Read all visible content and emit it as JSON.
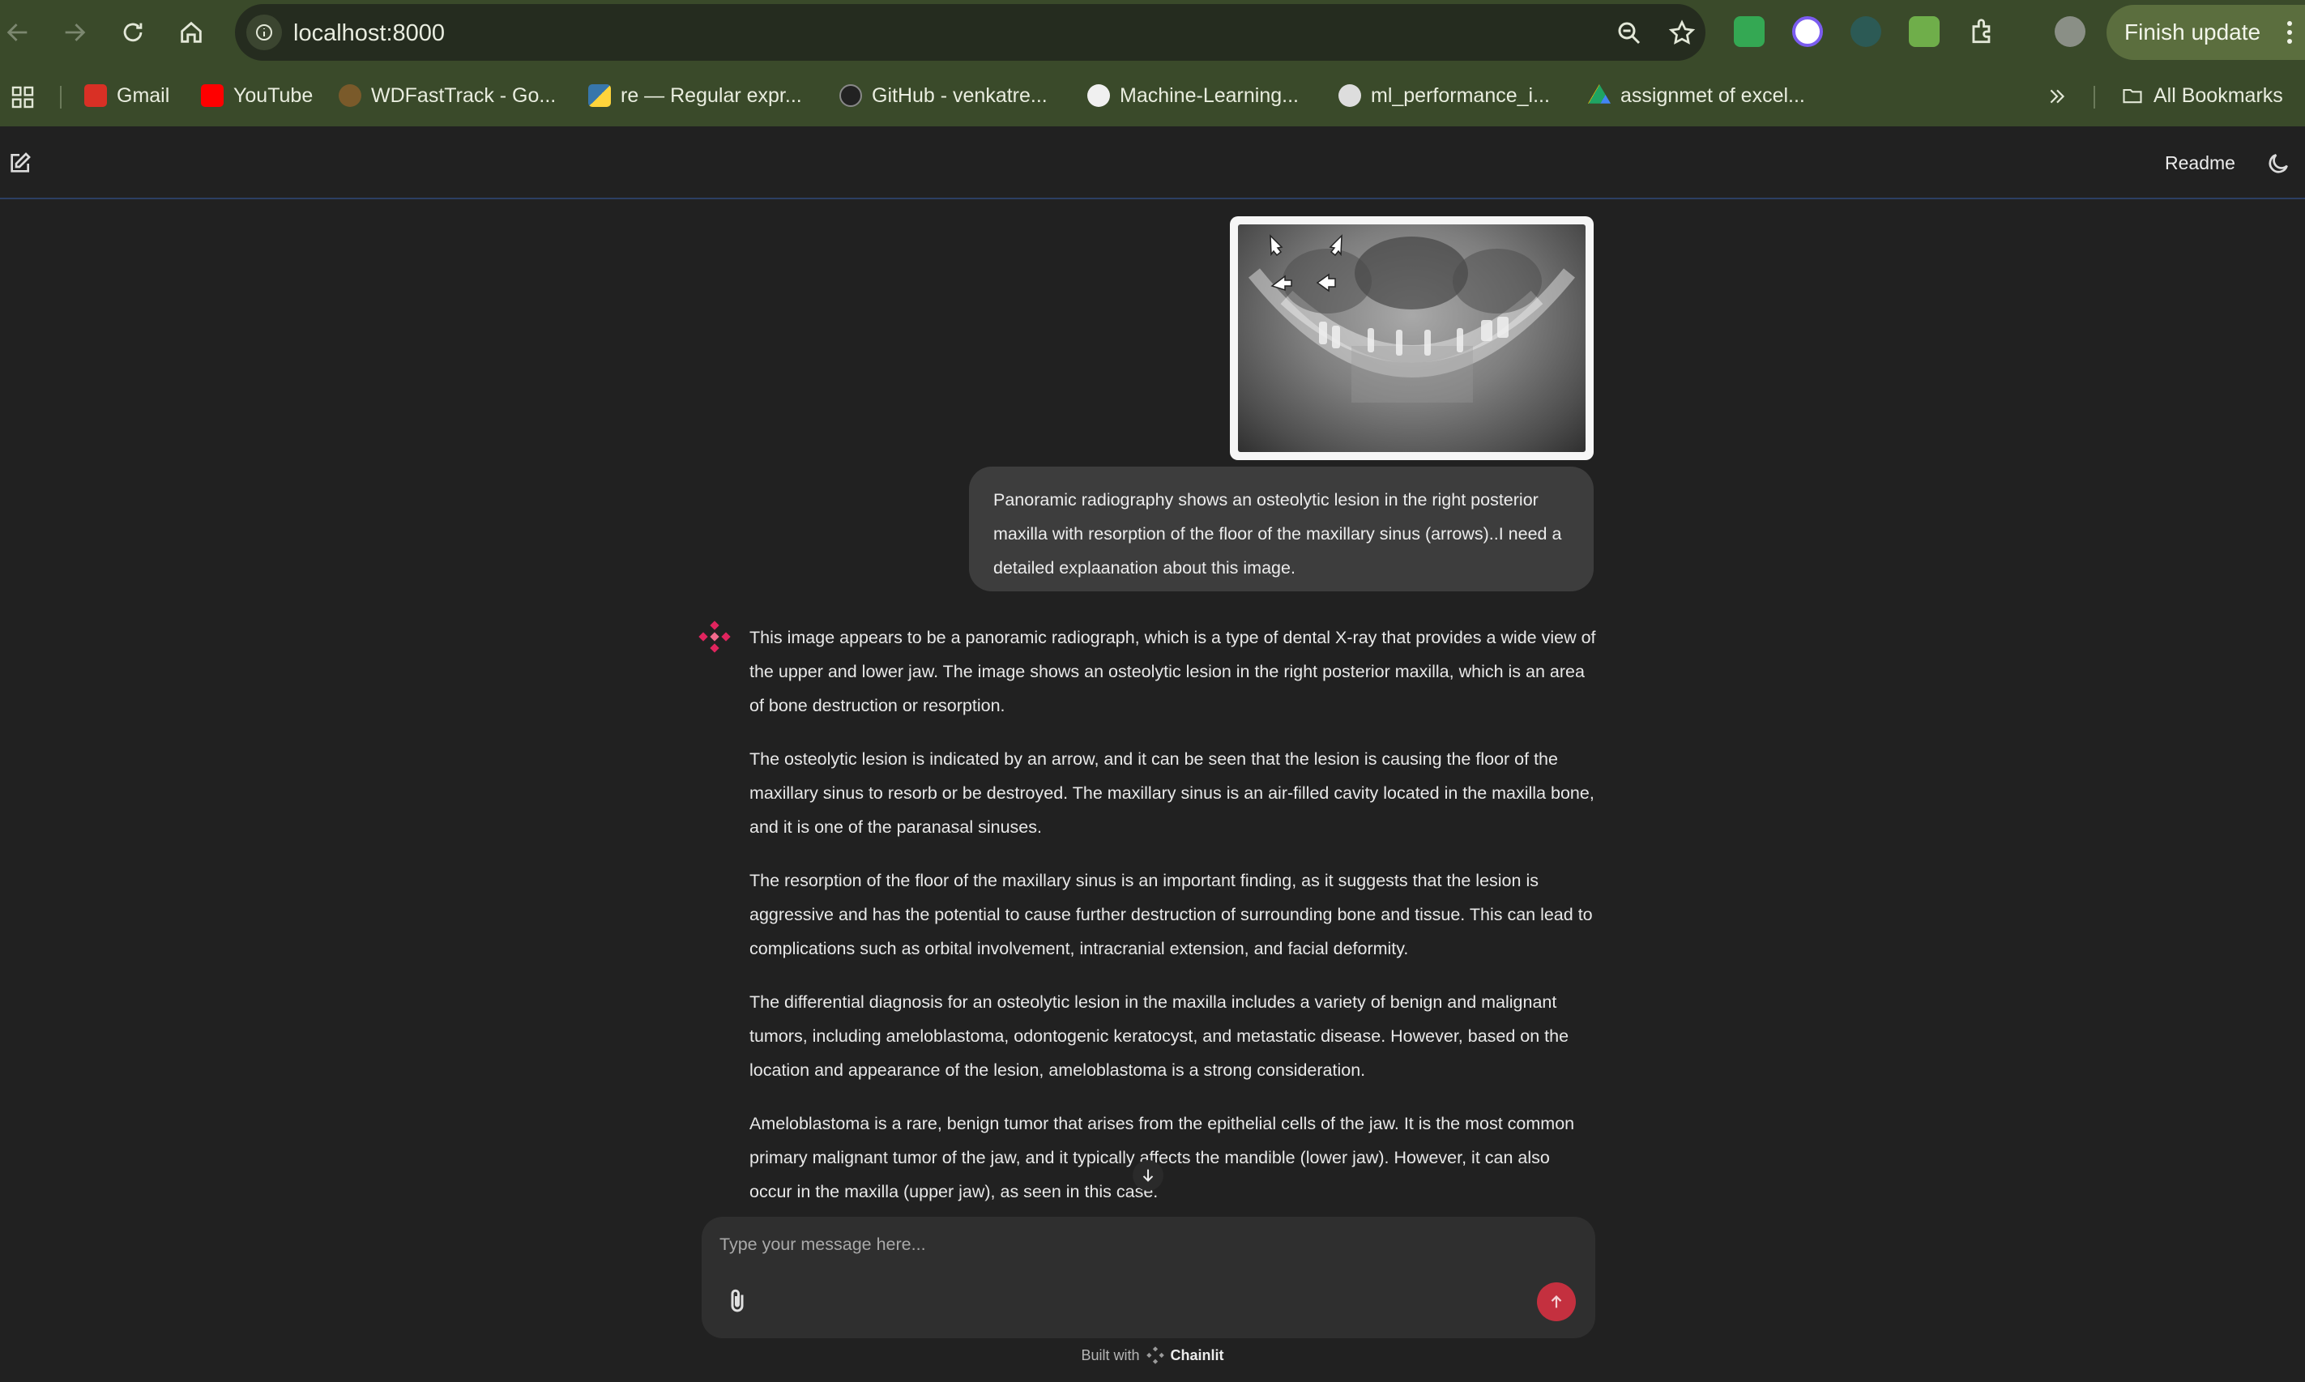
{
  "browser": {
    "url": "localhost:8000",
    "finish_update_label": "Finish update",
    "bookmarks": [
      {
        "label": "Gmail",
        "icon": "gmail-icon",
        "color": "#d93025"
      },
      {
        "label": "YouTube",
        "icon": "youtube-icon",
        "color": "#ff0000"
      },
      {
        "label": "WDFastTrack - Go...",
        "icon": "globe-icon",
        "color": "#7a5a2a"
      },
      {
        "label": "re — Regular expr...",
        "icon": "python-icon",
        "color": "#3776ab"
      },
      {
        "label": "GitHub - venkatre...",
        "icon": "github-icon",
        "color": "#222222"
      },
      {
        "label": "Machine-Learning...",
        "icon": "github-icon",
        "color": "#222222"
      },
      {
        "label": "ml_performance_i...",
        "icon": "globe-icon",
        "color": "#555555"
      },
      {
        "label": "assignmet of excel...",
        "icon": "drive-icon",
        "color": "#1fa463"
      }
    ],
    "all_bookmarks_label": "All Bookmarks"
  },
  "header": {
    "readme_label": "Readme"
  },
  "chat": {
    "user_message": "Panoramic radiography shows an osteolytic lesion in the right posterior maxilla with resorption of the floor of the maxillary sinus (arrows)..I need a detailed explaanation about this image.",
    "assistant_paragraphs": [
      "This image appears to be a panoramic radiograph, which is a type of dental X-ray that provides a wide view of the upper and lower jaw. The image shows an osteolytic lesion in the right posterior maxilla, which is an area of bone destruction or resorption.",
      "The osteolytic lesion is indicated by an arrow, and it can be seen that the lesion is causing the floor of the maxillary sinus to resorb or be destroyed. The maxillary sinus is an air-filled cavity located in the maxilla bone, and it is one of the paranasal sinuses.",
      "The resorption of the floor of the maxillary sinus is an important finding, as it suggests that the lesion is aggressive and has the potential to cause further destruction of surrounding bone and tissue. This can lead to complications such as orbital involvement, intracranial extension, and facial deformity.",
      "The differential diagnosis for an osteolytic lesion in the maxilla includes a variety of benign and malignant tumors, including ameloblastoma, odontogenic keratocyst, and metastatic disease. However, based on the location and appearance of the lesion, ameloblastoma is a strong consideration.",
      "Ameloblastoma is a rare, benign tumor that arises from the epithelial cells of the jaw. It is the most common primary malignant tumor of the jaw, and it typically affects the mandible (lower jaw). However, it can also occur in the maxilla (upper jaw), as seen in this case."
    ]
  },
  "composer": {
    "placeholder": "Type your message here..."
  },
  "footer": {
    "built_with": "Built with",
    "brand": "Chainlit"
  },
  "colors": {
    "accent": "#c4303f",
    "chrome": "#3a4a2a",
    "background": "#212121",
    "bubble": "#3d3d3d"
  }
}
